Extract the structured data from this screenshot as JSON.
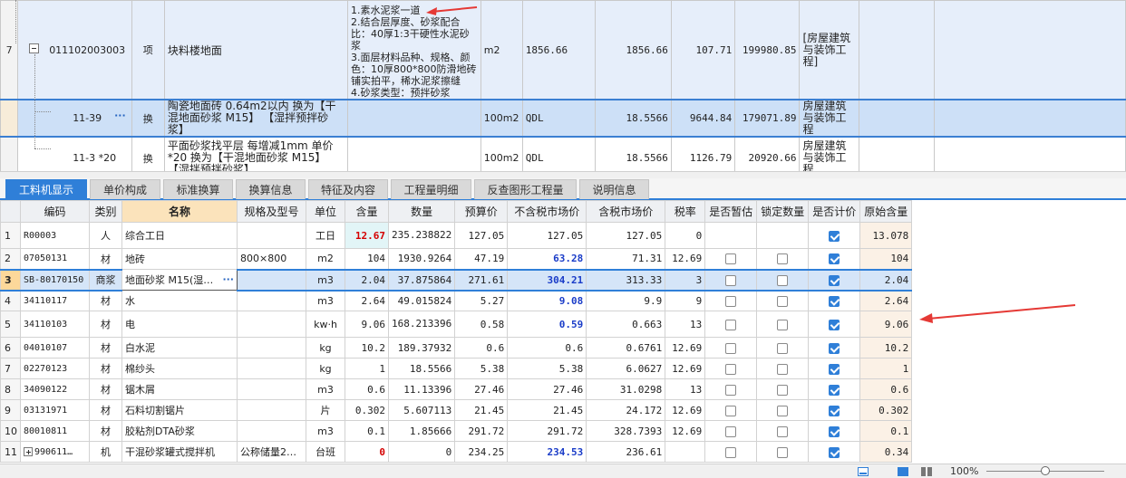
{
  "top_rows": [
    {
      "num": "7",
      "code": "011102003003",
      "type": "项",
      "name": "块料楼地面",
      "features": "1.素水泥浆一道\n2.结合层厚度、砂浆配合比：40厚1:3干硬性水泥砂浆\n3.面层材料品种、规格、颜色：10厚800*800防滑地砖铺实拍平，稀水泥浆擦缝\n4.砂浆类型：预拌砂浆",
      "unit": "m2",
      "qty_expr": "1856.66",
      "qty": "1856.66",
      "price": "107.71",
      "total": "199980.85",
      "specialty": "[房屋建筑与装饰工程]"
    },
    {
      "num": "",
      "code": "11-39",
      "dots": "···",
      "type": "换",
      "name": "陶瓷地面砖 0.64m2以内  换为【干混地面砂浆 M15】  【湿拌预拌砂浆】",
      "features": "",
      "unit": "100m2",
      "qty_expr": "QDL",
      "qty": "18.5566",
      "price": "9644.84",
      "total": "179071.89",
      "specialty": "房屋建筑与装饰工程"
    },
    {
      "num": "",
      "code": "11-3 *20",
      "type": "换",
      "name": "平面砂浆找平层 每增减1mm  单价*20 换为【干混地面砂浆 M15】 【湿拌预拌砂浆】",
      "features": "",
      "unit": "100m2",
      "qty_expr": "QDL",
      "qty": "18.5566",
      "price": "1126.79",
      "total": "20920.66",
      "specialty": "房屋建筑与装饰工程"
    }
  ],
  "tabs": [
    "工料机显示",
    "单价构成",
    "标准换算",
    "换算信息",
    "特征及内容",
    "工程量明细",
    "反查图形工程量",
    "说明信息"
  ],
  "active_tab": 0,
  "columns": [
    "编码",
    "类别",
    "名称",
    "规格及型号",
    "单位",
    "含量",
    "数量",
    "预算价",
    "不含税市场价",
    "含税市场价",
    "税率",
    "是否暂估",
    "锁定数量",
    "是否计价",
    "原始含量"
  ],
  "rows": [
    {
      "n": "1",
      "code": "R00003",
      "cat": "人",
      "name": "综合工日",
      "spec": "",
      "unit": "工日",
      "content": "12.67",
      "qty": "235.238822",
      "budget": "127.05",
      "mkt": "127.05",
      "mkt_tax": "127.05",
      "tax": "0",
      "est": false,
      "lock": false,
      "price_on": true,
      "orig": "13.078"
    },
    {
      "n": "2",
      "code": "07050131",
      "cat": "材",
      "name": "地砖",
      "spec": "800×800",
      "unit": "m2",
      "content": "104",
      "qty": "1930.9264",
      "budget": "47.19",
      "mkt": "63.28",
      "mkt_tax": "71.31",
      "tax": "12.69",
      "est": false,
      "lock": false,
      "price_on": true,
      "orig": "104"
    },
    {
      "n": "3",
      "code": "SB-80170150",
      "cat": "商浆",
      "name": "地面砂浆 M15(湿…",
      "dots": "···",
      "spec": "",
      "unit": "m3",
      "content": "2.04",
      "qty": "37.875864",
      "budget": "271.61",
      "mkt": "304.21",
      "mkt_tax": "313.33",
      "tax": "3",
      "est": false,
      "lock": false,
      "price_on": true,
      "orig": "2.04"
    },
    {
      "n": "4",
      "code": "34110117",
      "cat": "材",
      "name": "水",
      "spec": "",
      "unit": "m3",
      "content": "2.64",
      "qty": "49.015824",
      "budget": "5.27",
      "mkt": "9.08",
      "mkt_tax": "9.9",
      "tax": "9",
      "est": false,
      "lock": false,
      "price_on": true,
      "orig": "2.64"
    },
    {
      "n": "5",
      "code": "34110103",
      "cat": "材",
      "name": "电",
      "spec": "",
      "unit": "kw·h",
      "content": "9.06",
      "qty": "168.213396",
      "budget": "0.58",
      "mkt": "0.59",
      "mkt_tax": "0.663",
      "tax": "13",
      "est": false,
      "lock": false,
      "price_on": true,
      "orig": "9.06"
    },
    {
      "n": "6",
      "code": "04010107",
      "cat": "材",
      "name": "白水泥",
      "spec": "",
      "unit": "kg",
      "content": "10.2",
      "qty": "189.37932",
      "budget": "0.6",
      "mkt": "0.6",
      "mkt_tax": "0.6761",
      "tax": "12.69",
      "est": false,
      "lock": false,
      "price_on": true,
      "orig": "10.2"
    },
    {
      "n": "7",
      "code": "02270123",
      "cat": "材",
      "name": "棉纱头",
      "spec": "",
      "unit": "kg",
      "content": "1",
      "qty": "18.5566",
      "budget": "5.38",
      "mkt": "5.38",
      "mkt_tax": "6.0627",
      "tax": "12.69",
      "est": false,
      "lock": false,
      "price_on": true,
      "orig": "1"
    },
    {
      "n": "8",
      "code": "34090122",
      "cat": "材",
      "name": "锯木屑",
      "spec": "",
      "unit": "m3",
      "content": "0.6",
      "qty": "11.13396",
      "budget": "27.46",
      "mkt": "27.46",
      "mkt_tax": "31.0298",
      "tax": "13",
      "est": false,
      "lock": false,
      "price_on": true,
      "orig": "0.6"
    },
    {
      "n": "9",
      "code": "03131971",
      "cat": "材",
      "name": "石料切割锯片",
      "spec": "",
      "unit": "片",
      "content": "0.302",
      "qty": "5.607113",
      "budget": "21.45",
      "mkt": "21.45",
      "mkt_tax": "24.172",
      "tax": "12.69",
      "est": false,
      "lock": false,
      "price_on": true,
      "orig": "0.302"
    },
    {
      "n": "10",
      "code": "80010811",
      "cat": "材",
      "name": "胶粘剂DTA砂浆",
      "spec": "",
      "unit": "m3",
      "content": "0.1",
      "qty": "1.85666",
      "budget": "291.72",
      "mkt": "291.72",
      "mkt_tax": "328.7393",
      "tax": "12.69",
      "est": false,
      "lock": false,
      "price_on": true,
      "orig": "0.1"
    },
    {
      "n": "11",
      "code": "990611…",
      "cat": "机",
      "name": "干混砂浆罐式搅拌机",
      "spec": "公称储量2…",
      "unit": "台班",
      "content": "0",
      "qty": "0",
      "budget": "234.25",
      "mkt": "234.53",
      "mkt_tax": "236.61",
      "tax": "",
      "est": false,
      "lock": false,
      "price_on": true,
      "orig": "0.34"
    }
  ],
  "status": {
    "zoom": "100%"
  },
  "colors": {
    "accent": "#2f7fd8",
    "selected_row": "#cde0f7",
    "annotation_arrow": "#e53935",
    "price_blue": "#1a3cc8",
    "zero_red": "#d40000"
  }
}
